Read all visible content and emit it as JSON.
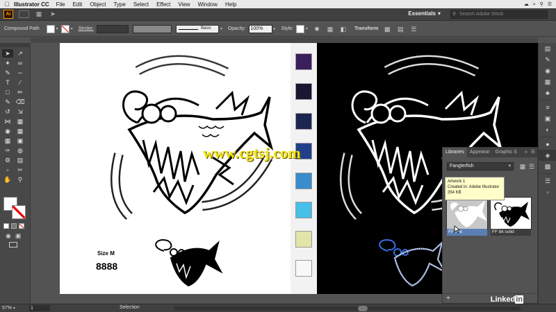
{
  "menubar": {
    "app_name": "Illustrator CC",
    "items": [
      "File",
      "Edit",
      "Object",
      "Type",
      "Select",
      "Effect",
      "View",
      "Window",
      "Help"
    ]
  },
  "appbar": {
    "logo": "Ai",
    "workspace": "Essentials",
    "search_placeholder": "Search Adobe Stock"
  },
  "controlbar": {
    "selection_type": "Compound Path",
    "stroke_label": "Stroke:",
    "stroke_profile": "Basic",
    "opacity_label": "Opacity:",
    "opacity_value": "100%",
    "style_label": "Style:",
    "transform_label": "Transform"
  },
  "canvas": {
    "size_label": "Size M",
    "number_label": "8888",
    "watermark": "www.cgtsj.com",
    "swatch_colors": [
      "#3a1f5c",
      "#1a1530",
      "#1b2550",
      "#22408a",
      "#3a8ccc",
      "#48bfe6",
      "#e2e4a8",
      "#f8f8f8"
    ]
  },
  "libraries": {
    "tabs": [
      "Libraries",
      "Appearar",
      "Graphic S"
    ],
    "selected_library": "Fanglerfish",
    "tooltip": {
      "title": "Artwork 1",
      "created": "Created in: Adobe Illustrator",
      "size": "354 KB"
    },
    "items": [
      {
        "label": "FF wht"
      },
      {
        "label": "FF bk solid"
      }
    ]
  },
  "status": {
    "zoom": "57%",
    "page": "1",
    "tool": "Selection"
  },
  "branding": {
    "text": "Linked",
    "in": "in"
  },
  "colors": {
    "accent": "#5a7fb5",
    "ai_orange": "#ff9a00",
    "selection_blue": "#3a6fe0"
  }
}
